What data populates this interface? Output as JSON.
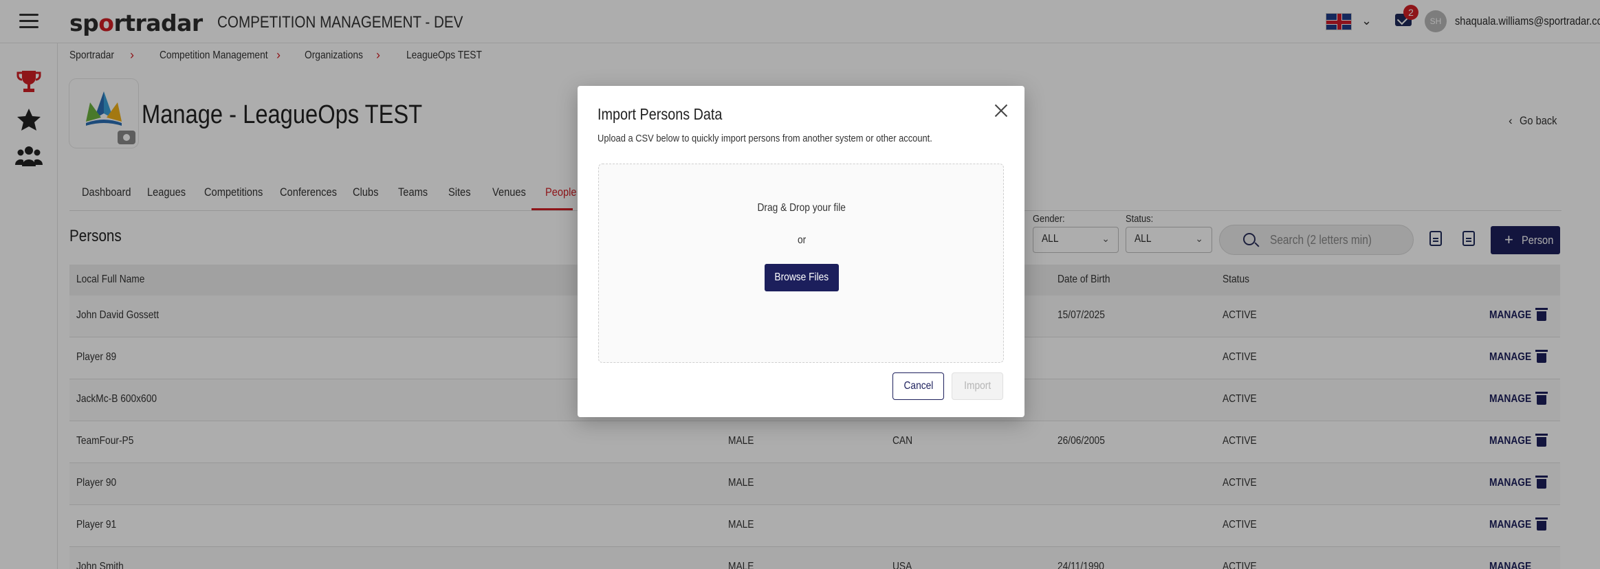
{
  "topbar": {
    "logo_text": "sportradar",
    "app_title": "COMPETITION MANAGEMENT - DEV",
    "language": "English (UK)",
    "notifications_count": "2",
    "avatar_initials": "SH",
    "user_email": "shaquala.williams@sportradar.com"
  },
  "sidenav": {
    "items": [
      "trophy-icon",
      "star-icon",
      "people-icon"
    ]
  },
  "breadcrumb": {
    "items": [
      {
        "label": "Sportradar"
      },
      {
        "label": "Competition Management"
      },
      {
        "label": "Organizations"
      },
      {
        "label": "LeagueOps TEST"
      }
    ]
  },
  "org": {
    "logo_text": "Organization Logo",
    "page_title": "Manage - LeagueOps TEST",
    "go_back": "Go back"
  },
  "tabs": [
    "Dashboard",
    "Leagues",
    "Competitions",
    "Conferences",
    "Clubs",
    "Teams",
    "Sites",
    "Venues",
    "People"
  ],
  "active_tab": "People",
  "section": {
    "title": "Persons",
    "gender_label": "Gender:",
    "gender_value": "ALL",
    "status_label": "Status:",
    "status_value": "ALL",
    "search_placeholder": "Search (2 letters min)",
    "add_button": "Person"
  },
  "table": {
    "headers": {
      "local_full_name": "Local Full Name",
      "date_of_birth": "Date of Birth",
      "status": "Status"
    },
    "manage_label": "MANAGE",
    "rows": [
      {
        "name": "John David Gossett",
        "gender": "",
        "nationality": "",
        "dob": "15/07/2025",
        "status": "ACTIVE"
      },
      {
        "name": "Player 89",
        "gender": "",
        "nationality": "",
        "dob": "",
        "status": "ACTIVE"
      },
      {
        "name": "JackMc-B 600x600",
        "gender": "",
        "nationality": "",
        "dob": "",
        "status": "ACTIVE"
      },
      {
        "name": "TeamFour-P5",
        "gender": "MALE",
        "nationality": "CAN",
        "dob": "26/06/2005",
        "status": "ACTIVE"
      },
      {
        "name": "Player 90",
        "gender": "MALE",
        "nationality": "",
        "dob": "",
        "status": "ACTIVE"
      },
      {
        "name": "Player 91",
        "gender": "MALE",
        "nationality": "",
        "dob": "",
        "status": "ACTIVE"
      },
      {
        "name": "John Smith",
        "gender": "MALE",
        "nationality": "USA",
        "dob": "24/11/1990",
        "status": "ACTIVE"
      }
    ]
  },
  "modal": {
    "title": "Import Persons Data",
    "subtitle": "Upload a CSV below to quickly import persons from another system or other account.",
    "drag_text": "Drag & Drop your file",
    "or_text": "or",
    "browse_label": "Browse Files",
    "cancel_label": "Cancel",
    "import_label": "Import"
  },
  "colors": {
    "brand_red": "#d11f26",
    "navy": "#1c1f5c",
    "overlay": "rgba(0,0,0,0.32)"
  }
}
